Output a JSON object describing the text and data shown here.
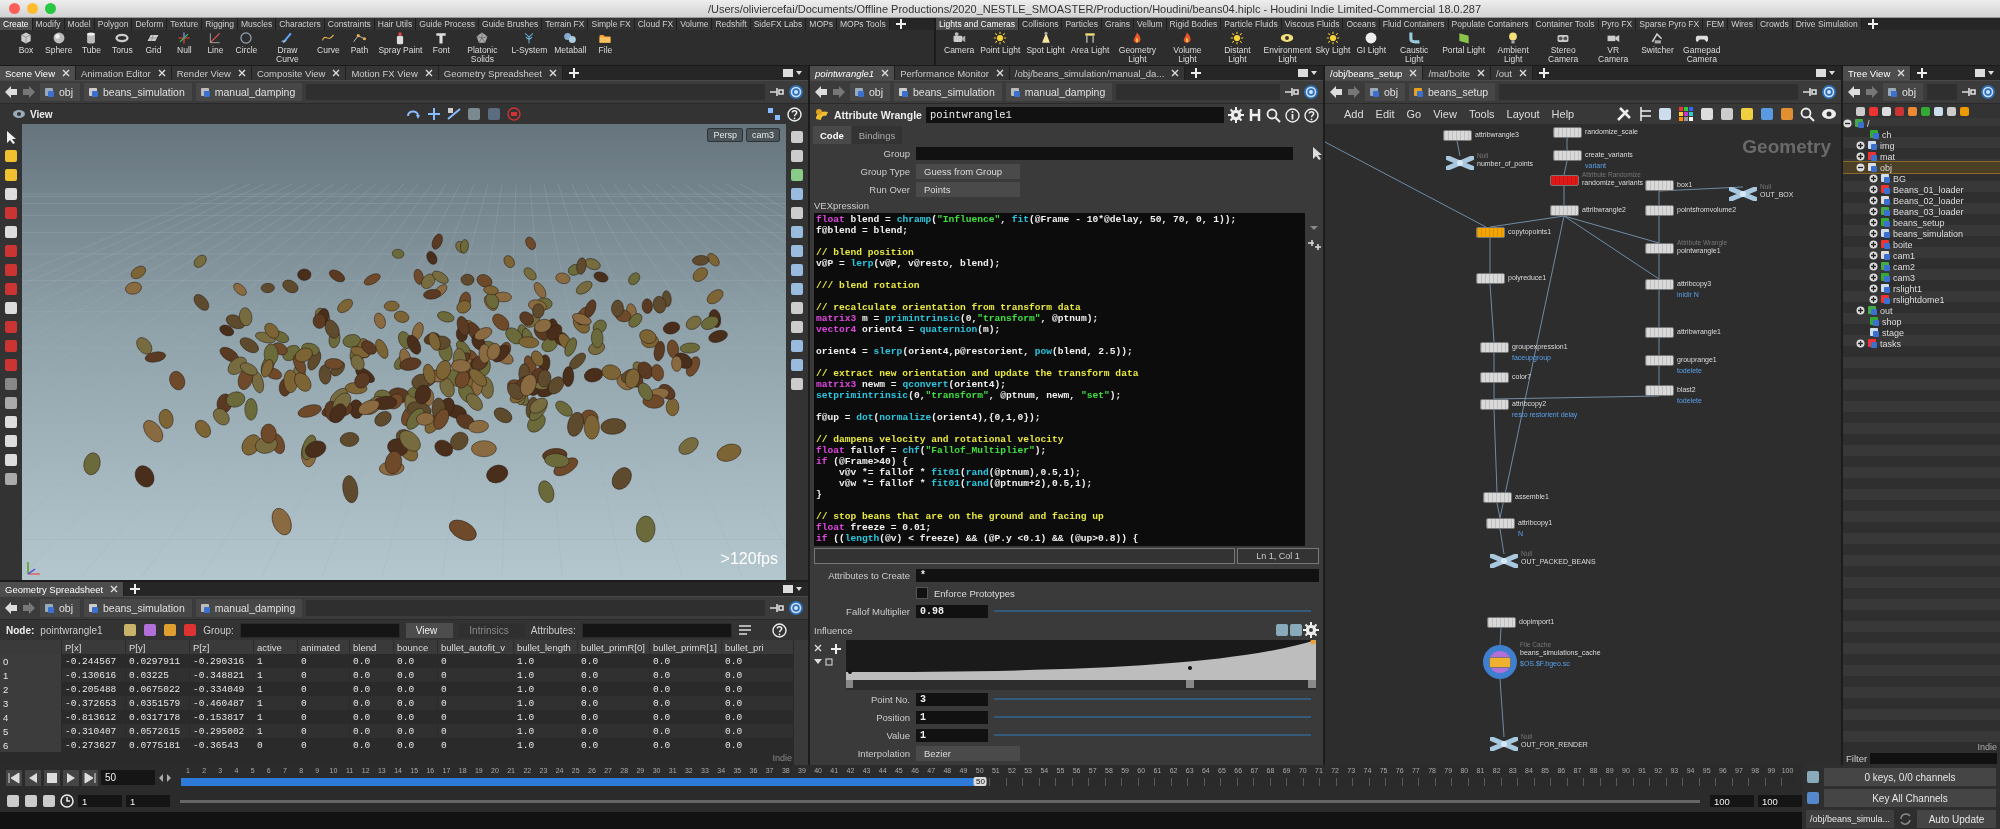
{
  "window": {
    "title": "/Users/oliviercefai/Documents/Offline Productions/2020_NESTLE_SMOASTER/Production/Houdini/beans04.hiplc - Houdini Indie Limited-Commercial 18.0.287"
  },
  "shelf": {
    "left_tabs": [
      {
        "label": "Create",
        "selected": true
      },
      {
        "label": "Modify",
        "selected": false
      },
      {
        "label": "Model",
        "selected": false
      },
      {
        "label": "Polygon",
        "selected": false
      },
      {
        "label": "Deform",
        "selected": false
      },
      {
        "label": "Texture",
        "selected": false
      },
      {
        "label": "Rigging",
        "selected": false
      },
      {
        "label": "Muscles",
        "selected": false
      },
      {
        "label": "Characters",
        "selected": false
      },
      {
        "label": "Constraints",
        "selected": false
      },
      {
        "label": "Hair Utils",
        "selected": false
      },
      {
        "label": "Guide Process",
        "selected": false
      },
      {
        "label": "Guide Brushes",
        "selected": false
      },
      {
        "label": "Terrain FX",
        "selected": false
      },
      {
        "label": "Simple FX",
        "selected": false
      },
      {
        "label": "Cloud FX",
        "selected": false
      },
      {
        "label": "Volume",
        "selected": false
      },
      {
        "label": "Redshift",
        "selected": false
      },
      {
        "label": "SideFX Labs",
        "selected": false
      },
      {
        "label": "MOPs",
        "selected": false
      },
      {
        "label": "MOPs Tools",
        "selected": false
      }
    ],
    "right_tabs": [
      {
        "label": "Lights and Cameras",
        "selected": true
      },
      {
        "label": "Collisions",
        "selected": false
      },
      {
        "label": "Particles",
        "selected": false
      },
      {
        "label": "Grains",
        "selected": false
      },
      {
        "label": "Vellum",
        "selected": false
      },
      {
        "label": "Rigid Bodies",
        "selected": false
      },
      {
        "label": "Particle Fluids",
        "selected": false
      },
      {
        "label": "Viscous Fluids",
        "selected": false
      },
      {
        "label": "Oceans",
        "selected": false
      },
      {
        "label": "Fluid Containers",
        "selected": false
      },
      {
        "label": "Populate Containers",
        "selected": false
      },
      {
        "label": "Container Tools",
        "selected": false
      },
      {
        "label": "Pyro FX",
        "selected": false
      },
      {
        "label": "Sparse Pyro FX",
        "selected": false
      },
      {
        "label": "FEM",
        "selected": false
      },
      {
        "label": "Wires",
        "selected": false
      },
      {
        "label": "Crowds",
        "selected": false
      },
      {
        "label": "Drive Simulation",
        "selected": false
      }
    ],
    "left_tools": [
      "Box",
      "Sphere",
      "Tube",
      "Torus",
      "Grid",
      "Null",
      "Line",
      "Circle",
      "Draw Curve",
      "Curve",
      "Path",
      "Spray Paint",
      "Font",
      "Platonic Solids",
      "L-System",
      "Metaball",
      "File"
    ],
    "right_tools": [
      "Camera",
      "Point Light",
      "Spot Light",
      "Area Light",
      "Geometry Light",
      "Volume Light",
      "Distant Light",
      "Environment Light",
      "Sky Light",
      "GI Light",
      "Caustic Light",
      "Portal Light",
      "Ambient Light",
      "Stereo Camera",
      "VR Camera",
      "Switcher",
      "Gamepad Camera"
    ]
  },
  "scene_view": {
    "tabs": [
      {
        "label": "Scene View",
        "selected": true
      },
      {
        "label": "Animation Editor",
        "selected": false
      },
      {
        "label": "Render View",
        "selected": false
      },
      {
        "label": "Composite View",
        "selected": false
      },
      {
        "label": "Motion FX View",
        "selected": false
      },
      {
        "label": "Geometry Spreadsheet",
        "selected": false
      }
    ],
    "path": [
      "obj",
      "beans_simulation",
      "manual_damping"
    ],
    "toolbar_label": "View",
    "camera_buttons": [
      "Persp",
      "cam3"
    ],
    "fps": ">120fps"
  },
  "geometry_spreadsheet": {
    "tabs": [
      {
        "label": "Geometry Spreadsheet",
        "selected": true
      }
    ],
    "path": [
      "obj",
      "beans_simulation",
      "manual_damping"
    ],
    "node_label": "Node:",
    "node_name": "pointwrangle1",
    "group_label": "Group:",
    "view_button": "View",
    "intrinsics_button": "Intrinsics",
    "attributes_label": "Attributes:",
    "columns": [
      "",
      "P[x]",
      "P[y]",
      "P[z]",
      "active",
      "animated",
      "blend",
      "bounce",
      "bullet_autofit_v",
      "bullet_length",
      "bullet_primR[0]",
      "bullet_primR[1]",
      "bullet_pri"
    ],
    "rows": [
      [
        "0",
        "-0.244567",
        "0.0297911",
        "-0.290316",
        "1",
        "0",
        "0.0",
        "0.0",
        "0",
        "1.0",
        "0.0",
        "0.0",
        "0.0"
      ],
      [
        "1",
        "-0.130616",
        "0.03225",
        "-0.348821",
        "1",
        "0",
        "0.0",
        "0.0",
        "0",
        "1.0",
        "0.0",
        "0.0",
        "0.0"
      ],
      [
        "2",
        "-0.205488",
        "0.0675022",
        "-0.334049",
        "1",
        "0",
        "0.0",
        "0.0",
        "0",
        "1.0",
        "0.0",
        "0.0",
        "0.0"
      ],
      [
        "3",
        "-0.372653",
        "0.0351579",
        "-0.460487",
        "1",
        "0",
        "0.0",
        "0.0",
        "0",
        "1.0",
        "0.0",
        "0.0",
        "0.0"
      ],
      [
        "4",
        "-0.813612",
        "0.0317178",
        "-0.153817",
        "1",
        "0",
        "0.0",
        "0.0",
        "0",
        "1.0",
        "0.0",
        "0.0",
        "0.0"
      ],
      [
        "5",
        "-0.310407",
        "0.0572615",
        "-0.295002",
        "1",
        "0",
        "0.0",
        "0.0",
        "0",
        "1.0",
        "0.0",
        "0.0",
        "0.0"
      ],
      [
        "6",
        "-0.273627",
        "0.0775181",
        "-0.36543",
        "0",
        "0",
        "0.0",
        "0.0",
        "0",
        "1.0",
        "0.0",
        "0.0",
        "0.0"
      ]
    ],
    "edition_label": "Indie"
  },
  "parameters": {
    "tabs": [
      {
        "label": "pointwrangle1",
        "selected": true
      },
      {
        "label": "Performance Monitor",
        "selected": false
      },
      {
        "label": "/obj/beans_simulation/manual_da...",
        "selected": false
      }
    ],
    "path": [
      "obj",
      "beans_simulation",
      "manual_damping"
    ],
    "node_type": "Attribute Wrangle",
    "node_name": "pointwrangle1",
    "param_tabs": [
      {
        "label": "Code",
        "selected": true
      },
      {
        "label": "Bindings",
        "selected": false
      }
    ],
    "group_label": "Group",
    "group_type": {
      "label": "Group Type",
      "value": "Guess from Group"
    },
    "run_over": {
      "label": "Run Over",
      "value": "Points"
    },
    "vex_label": "VEXpression",
    "code": [
      {
        "kind": "code",
        "tokens": [
          {
            "kind": "type",
            "text": "float"
          },
          {
            "kind": "plain",
            "text": " blend = "
          },
          {
            "kind": "func",
            "text": "chramp"
          },
          {
            "kind": "plain",
            "text": "("
          },
          {
            "kind": "str",
            "text": "\"Influence\""
          },
          {
            "kind": "plain",
            "text": ", "
          },
          {
            "kind": "func",
            "text": "fit"
          },
          {
            "kind": "plain",
            "text": "(@Frame - 10*@delay, 50, 70, 0, 1));"
          }
        ]
      },
      {
        "kind": "code",
        "tokens": [
          {
            "kind": "plain",
            "text": "f@blend = blend;"
          }
        ]
      },
      {
        "kind": "blank"
      },
      {
        "kind": "code",
        "tokens": [
          {
            "kind": "comment",
            "text": "// blend position"
          }
        ]
      },
      {
        "kind": "code",
        "tokens": [
          {
            "kind": "plain",
            "text": "v@P = "
          },
          {
            "kind": "func",
            "text": "lerp"
          },
          {
            "kind": "plain",
            "text": "(v@P, v@resto, blend);"
          }
        ]
      },
      {
        "kind": "blank"
      },
      {
        "kind": "code",
        "tokens": [
          {
            "kind": "comment",
            "text": "/// blend rotation"
          }
        ]
      },
      {
        "kind": "blank"
      },
      {
        "kind": "code",
        "tokens": [
          {
            "kind": "comment",
            "text": "// recalculate orientation from transform data"
          }
        ]
      },
      {
        "kind": "code",
        "tokens": [
          {
            "kind": "type",
            "text": "matrix3"
          },
          {
            "kind": "plain",
            "text": " m = "
          },
          {
            "kind": "func",
            "text": "primintrinsic"
          },
          {
            "kind": "plain",
            "text": "(0,"
          },
          {
            "kind": "str",
            "text": "\"transform\""
          },
          {
            "kind": "plain",
            "text": ", @ptnum);"
          }
        ]
      },
      {
        "kind": "code",
        "tokens": [
          {
            "kind": "type",
            "text": "vector4"
          },
          {
            "kind": "plain",
            "text": " orient4 = "
          },
          {
            "kind": "func",
            "text": "quaternion"
          },
          {
            "kind": "plain",
            "text": "(m);"
          }
        ]
      },
      {
        "kind": "blank"
      },
      {
        "kind": "code",
        "tokens": [
          {
            "kind": "plain",
            "text": "orient4 = "
          },
          {
            "kind": "func",
            "text": "slerp"
          },
          {
            "kind": "plain",
            "text": "(orient4,p@restorient, "
          },
          {
            "kind": "func",
            "text": "pow"
          },
          {
            "kind": "plain",
            "text": "(blend, 2.5));"
          }
        ]
      },
      {
        "kind": "blank"
      },
      {
        "kind": "code",
        "tokens": [
          {
            "kind": "comment",
            "text": "// extract new orientation and update the transform data"
          }
        ]
      },
      {
        "kind": "code",
        "tokens": [
          {
            "kind": "type",
            "text": "matrix3"
          },
          {
            "kind": "plain",
            "text": " newm = "
          },
          {
            "kind": "func",
            "text": "qconvert"
          },
          {
            "kind": "plain",
            "text": "(orient4);"
          }
        ]
      },
      {
        "kind": "code",
        "tokens": [
          {
            "kind": "func",
            "text": "setprimintrinsic"
          },
          {
            "kind": "plain",
            "text": "(0,"
          },
          {
            "kind": "str",
            "text": "\"transform\""
          },
          {
            "kind": "plain",
            "text": ", @ptnum, newm, "
          },
          {
            "kind": "str",
            "text": "\"set\""
          },
          {
            "kind": "plain",
            "text": ");"
          }
        ]
      },
      {
        "kind": "blank"
      },
      {
        "kind": "code",
        "tokens": [
          {
            "kind": "plain",
            "text": "f@up = "
          },
          {
            "kind": "func",
            "text": "dot"
          },
          {
            "kind": "plain",
            "text": "("
          },
          {
            "kind": "func",
            "text": "normalize"
          },
          {
            "kind": "plain",
            "text": "(orient4),{0,1,0});"
          }
        ]
      },
      {
        "kind": "blank"
      },
      {
        "kind": "code",
        "tokens": [
          {
            "kind": "comment",
            "text": "// dampens velocity and rotational velocity"
          }
        ]
      },
      {
        "kind": "code",
        "tokens": [
          {
            "kind": "type",
            "text": "float"
          },
          {
            "kind": "plain",
            "text": " fallof = "
          },
          {
            "kind": "func",
            "text": "chf"
          },
          {
            "kind": "plain",
            "text": "("
          },
          {
            "kind": "str",
            "text": "\"Fallof_Multiplier\""
          },
          {
            "kind": "plain",
            "text": ");"
          }
        ]
      },
      {
        "kind": "code",
        "tokens": [
          {
            "kind": "type",
            "text": "if"
          },
          {
            "kind": "plain",
            "text": " (@Frame>40) {"
          }
        ]
      },
      {
        "kind": "code",
        "tokens": [
          {
            "kind": "plain",
            "text": "    v@v *= fallof * "
          },
          {
            "kind": "func",
            "text": "fit01"
          },
          {
            "kind": "plain",
            "text": "("
          },
          {
            "kind": "func",
            "text": "rand"
          },
          {
            "kind": "plain",
            "text": "(@ptnum),0.5,1);"
          }
        ]
      },
      {
        "kind": "code",
        "tokens": [
          {
            "kind": "plain",
            "text": "    v@w *= fallof * "
          },
          {
            "kind": "func",
            "text": "fit01"
          },
          {
            "kind": "plain",
            "text": "("
          },
          {
            "kind": "func",
            "text": "rand"
          },
          {
            "kind": "plain",
            "text": "(@ptnum+2),0.5,1);"
          }
        ]
      },
      {
        "kind": "code",
        "tokens": [
          {
            "kind": "plain",
            "text": "}"
          }
        ]
      },
      {
        "kind": "blank"
      },
      {
        "kind": "code",
        "tokens": [
          {
            "kind": "comment",
            "text": "// stop beans that are on the ground and facing up"
          }
        ]
      },
      {
        "kind": "code",
        "tokens": [
          {
            "kind": "type",
            "text": "float"
          },
          {
            "kind": "plain",
            "text": " freeze = 0.01;"
          }
        ]
      },
      {
        "kind": "code",
        "tokens": [
          {
            "kind": "type",
            "text": "if"
          },
          {
            "kind": "plain",
            "text": " (("
          },
          {
            "kind": "func",
            "text": "length"
          },
          {
            "kind": "plain",
            "text": "(@v) < freeze) && (@P.y <0.1) && (@up>0.8)) {"
          }
        ]
      }
    ],
    "cursor_position": "Ln 1, Col 1",
    "attributes_to_create": {
      "label": "Attributes to Create",
      "value": "*"
    },
    "enforce_prototypes": {
      "label": "Enforce Prototypes",
      "checked": false
    },
    "fallof_multiplier": {
      "label": "Fallof Multiplier",
      "value": "0.98"
    },
    "influence": {
      "label": "Influence",
      "point_no": {
        "label": "Point No.",
        "value": "3"
      },
      "position": {
        "label": "Position",
        "value": "1"
      },
      "value": {
        "label": "Value",
        "value": "1"
      },
      "interpolation": {
        "label": "Interpolation",
        "value": "Bezier"
      }
    }
  },
  "network": {
    "tabs": [
      {
        "label": "/obj/beans_setup",
        "selected": true
      },
      {
        "label": "/mat/boite",
        "selected": false
      },
      {
        "label": "/out",
        "selected": false
      }
    ],
    "path": [
      "obj",
      "beans_setup"
    ],
    "menu": [
      "Add",
      "Edit",
      "Go",
      "View",
      "Tools",
      "Layout",
      "Help"
    ],
    "context_label": "Geometry",
    "nodes": [
      {
        "name": "attribwrangle3",
        "kind": "sop",
        "color": "#d9d9d9",
        "display": false
      },
      {
        "name": "number_of_points",
        "kind": "null",
        "type_label": "Null",
        "color": "#a8c8e0",
        "display": false
      },
      {
        "name": "randomize_scale",
        "kind": "sop",
        "color": "#d9d9d9",
        "display": false
      },
      {
        "name": "create_variants",
        "kind": "sop",
        "comment": "variant",
        "color": "#d9d9d9",
        "display": false
      },
      {
        "name": "randomize_variants",
        "kind": "sop",
        "type_label": "Attribute Randomize",
        "color": "#e01818",
        "display": false
      },
      {
        "name": "attribwrangle2",
        "kind": "sop",
        "color": "#d9d9d9",
        "display": false
      },
      {
        "name": "box1",
        "kind": "sop",
        "color": "#d9d9d9",
        "display": false
      },
      {
        "name": "OUT_BOX",
        "kind": "null",
        "type_label": "Null",
        "color": "#a8c8e0",
        "display": false
      },
      {
        "name": "pointsfromvolume2",
        "kind": "sop",
        "color": "#d9d9d9",
        "display": false
      },
      {
        "name": "copytopoints1",
        "kind": "sop",
        "color": "#f5a400",
        "display": false
      },
      {
        "name": "pointwrangle1",
        "kind": "sop",
        "type_label": "Attribute Wrangle",
        "color": "#d9d9d9",
        "display": false
      },
      {
        "name": "polyreduce1",
        "kind": "sop",
        "color": "#d9d9d9",
        "display": false
      },
      {
        "name": "attribcopy3",
        "kind": "sop",
        "comment": "inidir N",
        "color": "#d9d9d9",
        "display": false
      },
      {
        "name": "attribwrangle1",
        "kind": "sop",
        "color": "#d9d9d9",
        "display": false
      },
      {
        "name": "grouprange1",
        "kind": "sop",
        "comment": "todelete",
        "color": "#d9d9d9",
        "display": false
      },
      {
        "name": "groupexpression1",
        "kind": "sop",
        "comment": "faceupgroup",
        "color": "#d9d9d9",
        "display": false
      },
      {
        "name": "color7",
        "kind": "sop",
        "color": "#d9d9d9",
        "display": false
      },
      {
        "name": "blast2",
        "kind": "sop",
        "comment": "todelete",
        "color": "#d9d9d9",
        "display": false
      },
      {
        "name": "attribcopy2",
        "kind": "sop",
        "comment": "resto restorient delay",
        "color": "#d9d9d9",
        "display": false
      },
      {
        "name": "assemble1",
        "kind": "sop",
        "color": "#d9d9d9",
        "display": false
      },
      {
        "name": "attribcopy1",
        "kind": "sop",
        "comment": "N",
        "color": "#d9d9d9",
        "display": false
      },
      {
        "name": "OUT_PACKED_BEANS",
        "kind": "null",
        "type_label": "Null",
        "color": "#a8c8e0",
        "display": false
      },
      {
        "name": "dopimport1",
        "kind": "sop",
        "color": "#d9d9d9",
        "display": false
      },
      {
        "name": "beans_simulations_cache",
        "kind": "filecache",
        "type_label": "File Cache",
        "comment": "$OS.$F.bgeo.sc",
        "color": "#f0b030",
        "display": true
      },
      {
        "name": "OUT_FOR_RENDER",
        "kind": "null",
        "type_label": "Null",
        "color": "#a8c8e0",
        "display": false
      }
    ]
  },
  "tree_view": {
    "tabs": [
      {
        "label": "Tree View",
        "selected": true
      }
    ],
    "path": [
      "obj"
    ],
    "items": [
      {
        "label": "/",
        "expanded": true,
        "selected": false,
        "children": [
          {
            "label": "ch",
            "selected": false
          },
          {
            "label": "img",
            "expanded": false,
            "selected": false
          },
          {
            "label": "mat",
            "expanded": false,
            "selected": false
          },
          {
            "label": "obj",
            "expanded": true,
            "selected": true,
            "children": [
              {
                "label": "BG",
                "expanded": false,
                "selected": false
              },
              {
                "label": "Beans_01_loader",
                "expanded": false,
                "selected": false
              },
              {
                "label": "Beans_02_loader",
                "expanded": false,
                "selected": false
              },
              {
                "label": "Beans_03_loader",
                "expanded": false,
                "selected": false
              },
              {
                "label": "beans_setup",
                "expanded": false,
                "selected": false
              },
              {
                "label": "beans_simulation",
                "expanded": false,
                "selected": false
              },
              {
                "label": "boite",
                "expanded": false,
                "selected": false
              },
              {
                "label": "cam1",
                "expanded": false,
                "selected": false
              },
              {
                "label": "cam2",
                "expanded": false,
                "selected": false
              },
              {
                "label": "cam3",
                "expanded": false,
                "selected": false
              },
              {
                "label": "rslight1",
                "expanded": false,
                "selected": false
              },
              {
                "label": "rslightdome1",
                "expanded": false,
                "selected": false
              }
            ]
          },
          {
            "label": "out",
            "expanded": false,
            "selected": false
          },
          {
            "label": "shop",
            "selected": false
          },
          {
            "label": "stage",
            "selected": false
          },
          {
            "label": "tasks",
            "expanded": false,
            "selected": false
          }
        ]
      }
    ],
    "edition_label": "Indie",
    "filter_label": "Filter"
  },
  "keys": {
    "channels": "0 keys, 0/0 channels",
    "key_all": "Key All Channels",
    "path": "/obj/beans_simula...",
    "auto_update": "Auto Update"
  },
  "timeline": {
    "frame": "50",
    "marker": "50",
    "level": 0.495,
    "ticks": [
      "1",
      "2",
      "3",
      "4",
      "5",
      "6",
      "7",
      "8",
      "9",
      "10",
      "11",
      "12",
      "13",
      "14",
      "15",
      "16",
      "17",
      "18",
      "19",
      "20",
      "21",
      "22",
      "23",
      "24",
      "25",
      "26",
      "27",
      "28",
      "29",
      "30",
      "31",
      "32",
      "33",
      "34",
      "35",
      "36",
      "37",
      "38",
      "39",
      "40",
      "41",
      "42",
      "43",
      "44",
      "45",
      "46",
      "47",
      "48",
      "49",
      "50",
      "51",
      "52",
      "53",
      "54",
      "55",
      "56",
      "57",
      "58",
      "59",
      "60",
      "61",
      "62",
      "63",
      "64",
      "65",
      "66",
      "67",
      "68",
      "69",
      "70",
      "71",
      "72",
      "73",
      "74",
      "75",
      "76",
      "77",
      "78",
      "79",
      "80",
      "81",
      "82",
      "83",
      "84",
      "85",
      "86",
      "87",
      "88",
      "89",
      "90",
      "91",
      "92",
      "93",
      "94",
      "95",
      "96",
      "97",
      "98",
      "99",
      "100"
    ],
    "range_start": [
      "1",
      "1"
    ],
    "range_end": [
      "100",
      "100"
    ]
  }
}
